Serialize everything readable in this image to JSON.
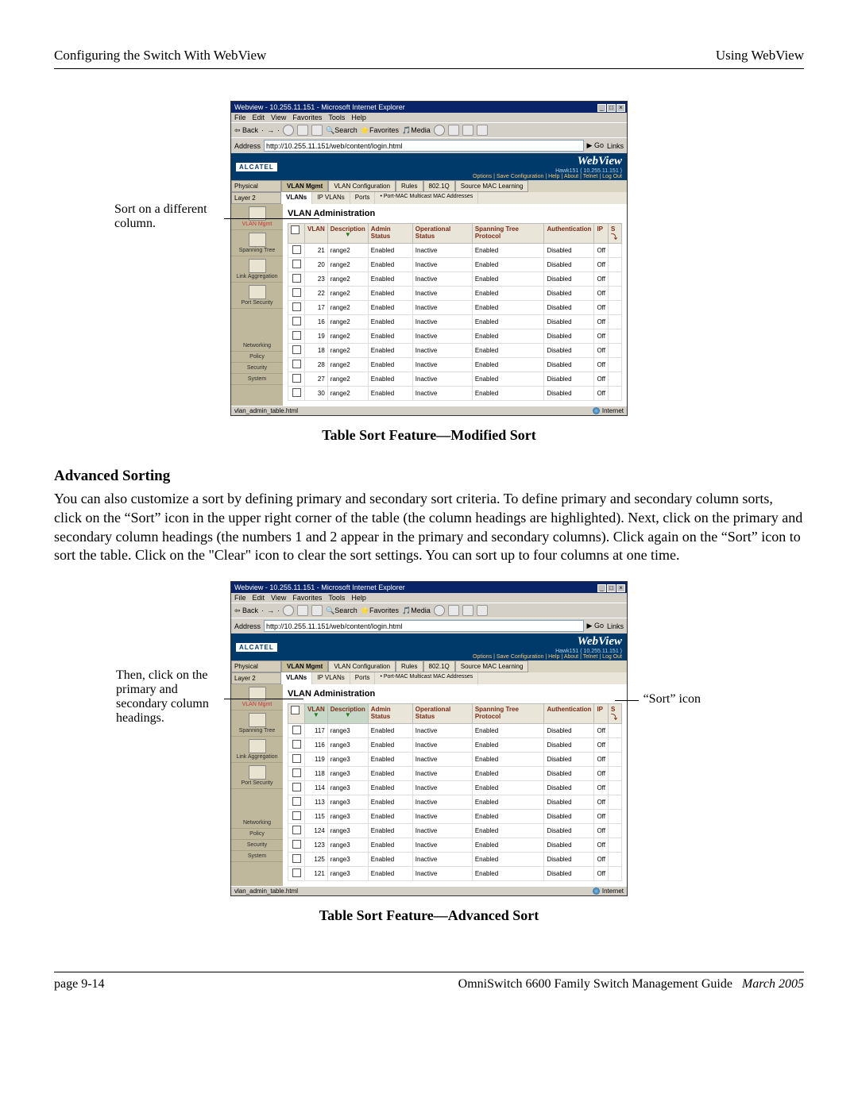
{
  "header": {
    "left": "Configuring the Switch With WebView",
    "right": "Using WebView"
  },
  "annotations": {
    "screenshot1_left": "Sort on a different column.",
    "screenshot2_left": "Then, click on the primary and secondary column headings.",
    "screenshot2_right": "“Sort” icon"
  },
  "caption1": "Table Sort Feature—Modified Sort",
  "section_title": "Advanced Sorting",
  "body": "You can also customize a sort by defining primary and secondary sort criteria. To define primary and secondary column sorts, click on the “Sort” icon in the upper right corner of the table (the column headings are highlighted). Next, click on the primary and secondary column headings (the numbers 1 and 2 appear in the primary and secondary columns). Click again on the “Sort” icon to sort the table. Click on the \"Clear\" icon to clear the sort settings. You can sort up to four columns at one time.",
  "caption2": "Table Sort Feature—Advanced Sort",
  "footer": {
    "left": "page 9-14",
    "center": "OmniSwitch 6600 Family Switch Management Guide",
    "date": "March 2005"
  },
  "browser": {
    "title": "Webview - 10.255.11.151 - Microsoft Internet Explorer",
    "menu": [
      "File",
      "Edit",
      "View",
      "Favorites",
      "Tools",
      "Help"
    ],
    "toolbar": {
      "back": "Back",
      "search": "Search",
      "favorites": "Favorites",
      "media": "Media"
    },
    "address_label": "Address",
    "url": "http://10.255.11.151/web/content/login.html",
    "go": "Go",
    "links": "Links",
    "status_left": "vlan_admin_table.html",
    "status_right": "Internet"
  },
  "webview": {
    "logo": "ALCATEL",
    "title": "WebView",
    "host": "Hawk151  ( 10.255.11.151 )",
    "options": "Options | Save Configuration | Help | About | Telnet | Log Out",
    "side_labels": {
      "physical": "Physical",
      "layer2": "Layer 2"
    },
    "tabs": [
      "VLAN Mgmt",
      "VLAN Configuration",
      "Rules",
      "802.1Q",
      "Source MAC Learning"
    ],
    "subtabs": [
      "VLANs",
      "IP VLANs",
      "Ports",
      "Port-MAC Multicast MAC Addresses"
    ],
    "left_nav": [
      "VLAN Mgmt",
      "Spanning Tree",
      "Link Aggregation",
      "Port Security",
      "Networking",
      "Policy",
      "Security",
      "System"
    ],
    "panel_title": "VLAN Administration",
    "columns": [
      "",
      "VLAN",
      "Description",
      "Admin Status",
      "Operational Status",
      "Spanning Tree Protocol",
      "Authentication",
      "IP"
    ],
    "rows1": [
      {
        "vlan": "21",
        "desc": "range2",
        "admin": "Enabled",
        "op": "Inactive",
        "stp": "Enabled",
        "auth": "Disabled",
        "ip": "Off"
      },
      {
        "vlan": "20",
        "desc": "range2",
        "admin": "Enabled",
        "op": "Inactive",
        "stp": "Enabled",
        "auth": "Disabled",
        "ip": "Off"
      },
      {
        "vlan": "23",
        "desc": "range2",
        "admin": "Enabled",
        "op": "Inactive",
        "stp": "Enabled",
        "auth": "Disabled",
        "ip": "Off"
      },
      {
        "vlan": "22",
        "desc": "range2",
        "admin": "Enabled",
        "op": "Inactive",
        "stp": "Enabled",
        "auth": "Disabled",
        "ip": "Off"
      },
      {
        "vlan": "17",
        "desc": "range2",
        "admin": "Enabled",
        "op": "Inactive",
        "stp": "Enabled",
        "auth": "Disabled",
        "ip": "Off"
      },
      {
        "vlan": "16",
        "desc": "range2",
        "admin": "Enabled",
        "op": "Inactive",
        "stp": "Enabled",
        "auth": "Disabled",
        "ip": "Off"
      },
      {
        "vlan": "19",
        "desc": "range2",
        "admin": "Enabled",
        "op": "Inactive",
        "stp": "Enabled",
        "auth": "Disabled",
        "ip": "Off"
      },
      {
        "vlan": "18",
        "desc": "range2",
        "admin": "Enabled",
        "op": "Inactive",
        "stp": "Enabled",
        "auth": "Disabled",
        "ip": "Off"
      },
      {
        "vlan": "28",
        "desc": "range2",
        "admin": "Enabled",
        "op": "Inactive",
        "stp": "Enabled",
        "auth": "Disabled",
        "ip": "Off"
      },
      {
        "vlan": "27",
        "desc": "range2",
        "admin": "Enabled",
        "op": "Inactive",
        "stp": "Enabled",
        "auth": "Disabled",
        "ip": "Off"
      },
      {
        "vlan": "30",
        "desc": "range2",
        "admin": "Enabled",
        "op": "Inactive",
        "stp": "Enabled",
        "auth": "Disabled",
        "ip": "Off"
      }
    ],
    "rows2": [
      {
        "vlan": "117",
        "desc": "range3",
        "admin": "Enabled",
        "op": "Inactive",
        "stp": "Enabled",
        "auth": "Disabled",
        "ip": "Off"
      },
      {
        "vlan": "116",
        "desc": "range3",
        "admin": "Enabled",
        "op": "Inactive",
        "stp": "Enabled",
        "auth": "Disabled",
        "ip": "Off"
      },
      {
        "vlan": "119",
        "desc": "range3",
        "admin": "Enabled",
        "op": "Inactive",
        "stp": "Enabled",
        "auth": "Disabled",
        "ip": "Off"
      },
      {
        "vlan": "118",
        "desc": "range3",
        "admin": "Enabled",
        "op": "Inactive",
        "stp": "Enabled",
        "auth": "Disabled",
        "ip": "Off"
      },
      {
        "vlan": "114",
        "desc": "range3",
        "admin": "Enabled",
        "op": "Inactive",
        "stp": "Enabled",
        "auth": "Disabled",
        "ip": "Off"
      },
      {
        "vlan": "113",
        "desc": "range3",
        "admin": "Enabled",
        "op": "Inactive",
        "stp": "Enabled",
        "auth": "Disabled",
        "ip": "Off"
      },
      {
        "vlan": "115",
        "desc": "range3",
        "admin": "Enabled",
        "op": "Inactive",
        "stp": "Enabled",
        "auth": "Disabled",
        "ip": "Off"
      },
      {
        "vlan": "124",
        "desc": "range3",
        "admin": "Enabled",
        "op": "Inactive",
        "stp": "Enabled",
        "auth": "Disabled",
        "ip": "Off"
      },
      {
        "vlan": "123",
        "desc": "range3",
        "admin": "Enabled",
        "op": "Inactive",
        "stp": "Enabled",
        "auth": "Disabled",
        "ip": "Off"
      },
      {
        "vlan": "125",
        "desc": "range3",
        "admin": "Enabled",
        "op": "Inactive",
        "stp": "Enabled",
        "auth": "Disabled",
        "ip": "Off"
      },
      {
        "vlan": "121",
        "desc": "range3",
        "admin": "Enabled",
        "op": "Inactive",
        "stp": "Enabled",
        "auth": "Disabled",
        "ip": "Off"
      }
    ]
  }
}
